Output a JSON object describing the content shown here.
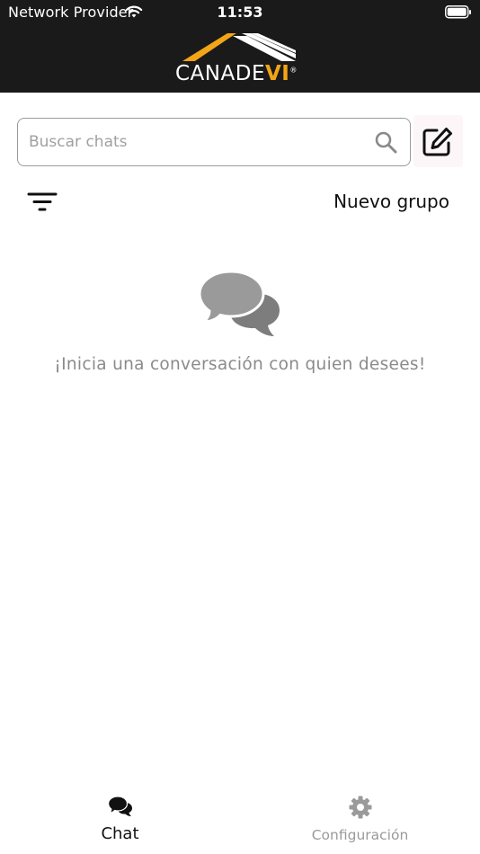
{
  "status_bar": {
    "carrier": "Network Provider",
    "time": "11:53"
  },
  "header": {
    "logo_main": "CANADE",
    "logo_accent": "VI",
    "logo_mark": "®"
  },
  "search": {
    "placeholder": "Buscar chats",
    "value": ""
  },
  "toolbar": {
    "new_group_label": "Nuevo grupo"
  },
  "empty_state": {
    "message": "¡Inicia una conversación con quien desees!"
  },
  "tabs": [
    {
      "label": "Chat",
      "icon": "chat-bubbles-icon",
      "active": true
    },
    {
      "label": "Configuración",
      "icon": "gear-icon",
      "active": false
    }
  ],
  "colors": {
    "header_bg": "#1a1a1a",
    "brand_accent": "#f2a516",
    "inactive": "#9a9a9a"
  }
}
